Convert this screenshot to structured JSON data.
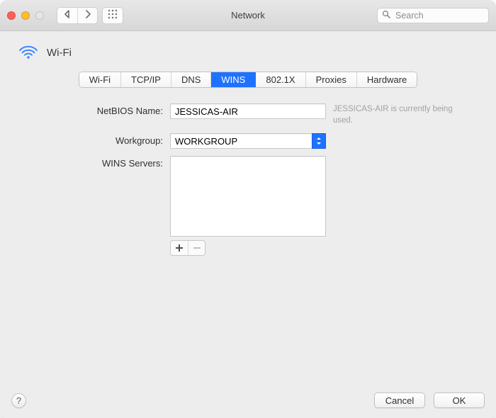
{
  "window": {
    "title": "Network",
    "search_placeholder": "Search"
  },
  "service": {
    "name": "Wi-Fi"
  },
  "tabs": [
    {
      "label": "Wi-Fi",
      "active": false
    },
    {
      "label": "TCP/IP",
      "active": false
    },
    {
      "label": "DNS",
      "active": false
    },
    {
      "label": "WINS",
      "active": true
    },
    {
      "label": "802.1X",
      "active": false
    },
    {
      "label": "Proxies",
      "active": false
    },
    {
      "label": "Hardware",
      "active": false
    }
  ],
  "form": {
    "netbios_label": "NetBIOS Name:",
    "netbios_value": "JESSICAS-AIR",
    "netbios_hint": "JESSICAS-AIR is currently being used.",
    "workgroup_label": "Workgroup:",
    "workgroup_value": "WORKGROUP",
    "wins_label": "WINS Servers:"
  },
  "footer": {
    "help_glyph": "?",
    "cancel": "Cancel",
    "ok": "OK"
  }
}
